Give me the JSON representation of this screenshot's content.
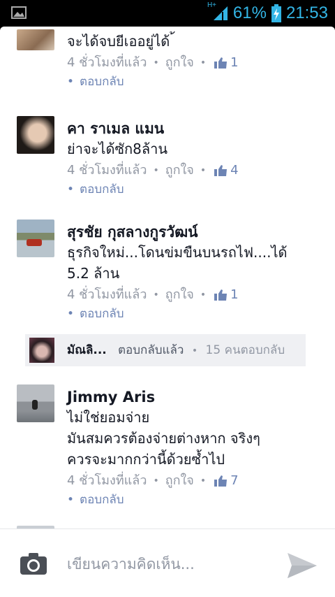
{
  "statusbar": {
    "network": "H+",
    "battery_percent": "61%",
    "time": "21:53"
  },
  "comments": [
    {
      "name": "",
      "text_lines": [
        "จะได้จบยีเออยู่ได้ ้"
      ],
      "time": "4 ชั่วโมงที่แล้ว",
      "like_label": "ถูกใจ",
      "like_count": "1",
      "reply_label": "ตอบกลับ"
    },
    {
      "name": "คา ราเมล แมน",
      "text_lines": [
        "ย่าจะได้ซัก8ล้าน"
      ],
      "time": "4 ชั่วโมงที่แล้ว",
      "like_label": "ถูกใจ",
      "like_count": "4",
      "reply_label": "ตอบกลับ"
    },
    {
      "name": "สุรชัย กุสลางกูรวัฒน์",
      "text_lines": [
        "ธุรกิจใหม่...โดนข่มขืนบนรถไฟ....ได้",
        "5.2 ล้าน"
      ],
      "time": "4 ชั่วโมงที่แล้ว",
      "like_label": "ถูกใจ",
      "like_count": "1",
      "reply_label": "ตอบกลับ"
    },
    {
      "name": "Jimmy Aris",
      "text_lines": [
        "ไม่ใช่ยอมจ่าย",
        "มันสมควรต้องจ่ายต่างหาก  จริงๆ",
        "ควรจะมากกว่านี้ด้วยซ้ำไป"
      ],
      "time": "4 ชั่วโมงที่แล้ว",
      "like_label": "ถูกใจ",
      "like_count": "7",
      "reply_label": "ตอบกลับ"
    }
  ],
  "reply_summary": {
    "name": "มัณลิ...",
    "action": "ตอบกลับแล้ว",
    "count_text": "15 คนตอบกลับ"
  },
  "composer": {
    "placeholder": "เขียนความคิดเห็น..."
  },
  "colors": {
    "accent": "#33b5e5",
    "link": "#6d84b4",
    "meta": "#9197a3"
  }
}
